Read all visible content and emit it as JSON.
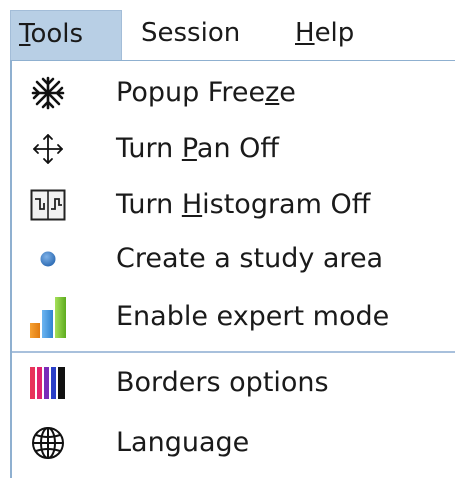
{
  "menubar": {
    "items": [
      {
        "label": "Tools",
        "mnemonic_index": 0,
        "active": true
      },
      {
        "label": "Session",
        "mnemonic_index": -1,
        "active": false
      },
      {
        "label": "Help",
        "mnemonic_index": 0,
        "active": false
      }
    ]
  },
  "dropdown": {
    "group1": [
      {
        "pre": "Popup Free",
        "ul": "z",
        "post": "e",
        "icon": "snowflake-icon"
      },
      {
        "pre": "Turn ",
        "ul": "P",
        "post": "an Off",
        "icon": "pan-arrows-icon"
      },
      {
        "pre": "Turn ",
        "ul": "H",
        "post": "istogram Off",
        "icon": "histogram-icon"
      },
      {
        "pre": "Create a study area",
        "ul": "",
        "post": "",
        "icon": "blue-dot-icon"
      },
      {
        "pre": "Enable expert mode",
        "ul": "",
        "post": "",
        "icon": "bar-chart-icon"
      }
    ],
    "group2": [
      {
        "pre": "Borders options",
        "ul": "",
        "post": "",
        "icon": "color-stripes-icon"
      },
      {
        "pre": "Language",
        "ul": "",
        "post": "",
        "icon": "globe-icon"
      }
    ]
  },
  "colors": {
    "active_menu_bg": "#b8cfe5",
    "separator": "#a8c0dc",
    "dot_blue": "#3d7fc4"
  }
}
